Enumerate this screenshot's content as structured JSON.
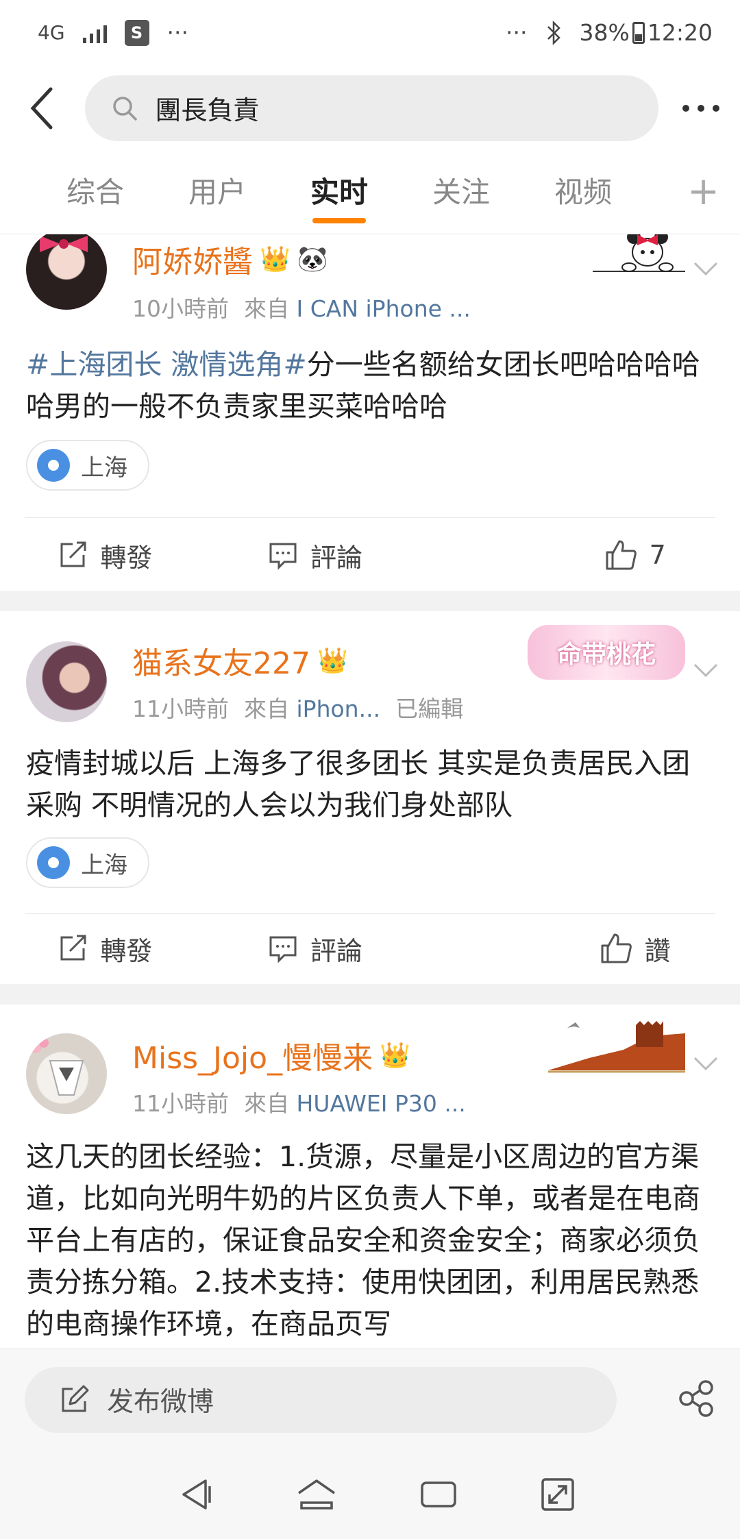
{
  "status_bar": {
    "network": "4G",
    "dots": "···",
    "right_dots": "···",
    "battery": "38%",
    "time": "12:20"
  },
  "search": {
    "query": "團長負責"
  },
  "tabs": [
    {
      "label": "综合"
    },
    {
      "label": "用户"
    },
    {
      "label": "实时"
    },
    {
      "label": "关注"
    },
    {
      "label": "视频"
    }
  ],
  "tab_plus": "+",
  "posts": [
    {
      "username": "阿娇娇醬",
      "time": "10小時前",
      "from_label": "來自",
      "source": "I CAN iPhone ...",
      "edited": "",
      "topic": "#上海团长 激情选角#",
      "text": "分一些名额给女团长吧哈哈哈哈哈男的一般不负责家里买菜哈哈哈",
      "location": "上海",
      "repost": "轉發",
      "comment": "評論",
      "like": "7"
    },
    {
      "username": "猫系女友227",
      "time": "11小時前",
      "from_label": "來自",
      "source": "iPhon...",
      "edited": "已編輯",
      "text": "疫情封城以后 上海多了很多团长 其实是负责居民入团采购 不明情况的人会以为我们身处部队",
      "location": "上海",
      "repost": "轉發",
      "comment": "評論",
      "like": "讚",
      "badge_text": "命带桃花"
    },
    {
      "username": "Miss_Jojo_慢慢来",
      "time": "11小時前",
      "from_label": "來自",
      "source": "HUAWEI P30 ...",
      "edited": "",
      "text": "这几天的团长经验：1.货源，尽量是小区周边的官方渠道，比如向光明牛奶的片区负责人下单，或者是在电商平台上有店的，保证食品安全和资金安全；商家必须负责分拣分箱。2.技术支持：使用快团团，利用居民熟悉的电商操作环境，在商品页写"
    }
  ],
  "compose": {
    "label": "发布微博"
  },
  "colors": {
    "accent": "#ff8200",
    "username": "#e8731c",
    "link": "#53779e"
  }
}
